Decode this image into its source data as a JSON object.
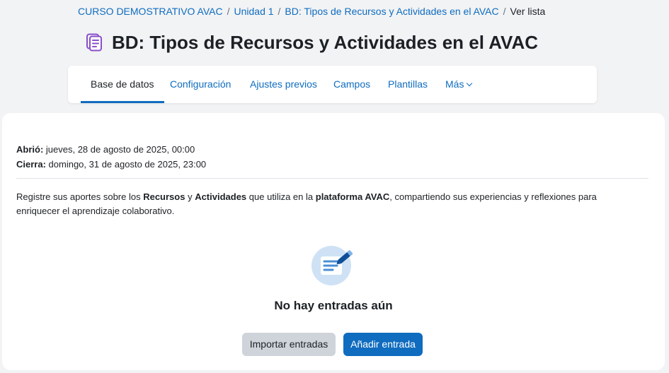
{
  "breadcrumb": {
    "items": [
      "CURSO DEMOSTRATIVO AVAC",
      "Unidad 1",
      "BD: Tipos de Recursos y Actividades en el AVAC"
    ],
    "current": "Ver lista"
  },
  "page": {
    "title": "BD: Tipos de Recursos y Actividades en el AVAC"
  },
  "tabs": [
    {
      "label": "Base de datos",
      "active": true
    },
    {
      "label": "Configuración"
    },
    {
      "label": "Ajustes previos"
    },
    {
      "label": "Campos"
    },
    {
      "label": "Plantillas"
    },
    {
      "label": "Más"
    }
  ],
  "dates": {
    "opened_label": "Abrió:",
    "opened_value": " jueves, 28 de agosto de 2025, 00:00",
    "closes_label": "Cierra:",
    "closes_value": " domingo, 31 de agosto de 2025, 23:00"
  },
  "intro": {
    "part1": "Registre sus aportes sobre los ",
    "bold1": "Recursos",
    "part2": " y ",
    "bold2": "Actividades",
    "part3": " que utiliza en la ",
    "bold3": "plataforma AVAC",
    "part4": ", compartiendo sus experiencias y reflexiones para enriquecer el aprendizaje colaborativo."
  },
  "empty_state": {
    "title": "No hay entradas aún",
    "import_label": "Importar entradas",
    "add_label": "Añadir entrada"
  },
  "colors": {
    "accent": "#0f6cbf",
    "module_icon": "#8a4fc9"
  }
}
